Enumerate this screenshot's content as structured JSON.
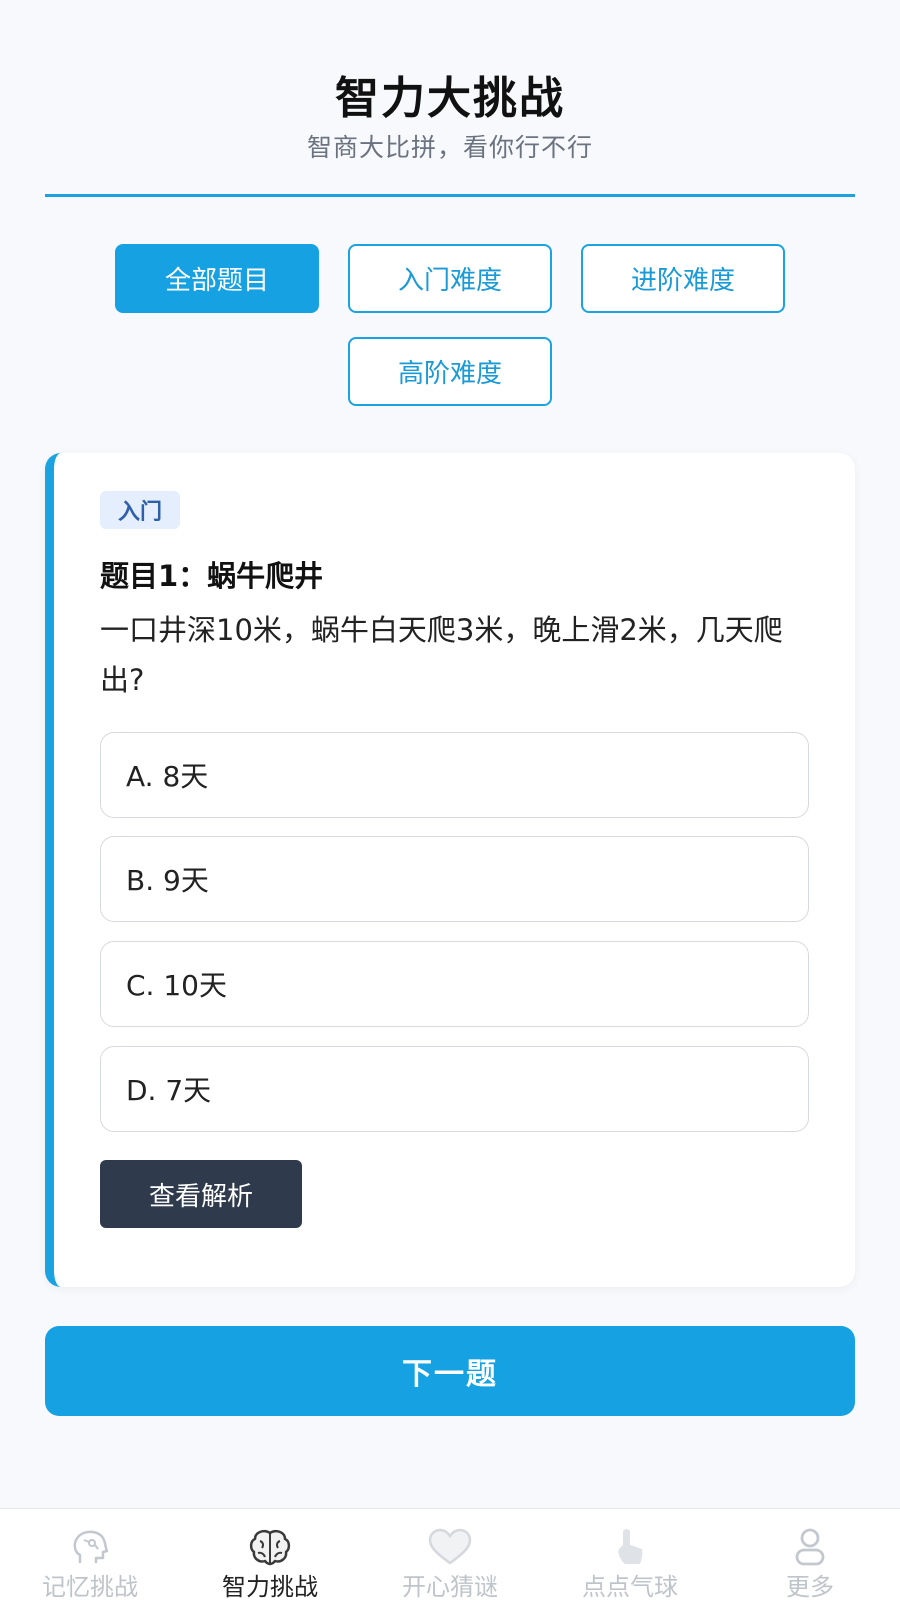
{
  "header": {
    "title": "智力大挑战",
    "subtitle": "智商大比拼，看你行不行"
  },
  "filters": [
    {
      "label": "全部题目",
      "active": true
    },
    {
      "label": "入门难度",
      "active": false
    },
    {
      "label": "进阶难度",
      "active": false
    },
    {
      "label": "高阶难度",
      "active": false
    }
  ],
  "question": {
    "level": "入门",
    "title": "题目1：蜗牛爬井",
    "text": "一口井深10米，蜗牛白天爬3米，晚上滑2米，几天爬出?",
    "options": [
      "A. 8天",
      "B. 9天",
      "C. 10天",
      "D. 7天"
    ],
    "analysis_label": "查看解析"
  },
  "next_label": "下一题",
  "tabs": [
    {
      "label": "记忆挑战",
      "icon": "head-icon"
    },
    {
      "label": "智力挑战",
      "icon": "brain-icon"
    },
    {
      "label": "开心猜谜",
      "icon": "heart-icon"
    },
    {
      "label": "点点气球",
      "icon": "tap-icon"
    },
    {
      "label": "更多",
      "icon": "person-icon"
    }
  ],
  "colors": {
    "accent": "#16a2e2",
    "dark_button": "#2f3b4d"
  }
}
